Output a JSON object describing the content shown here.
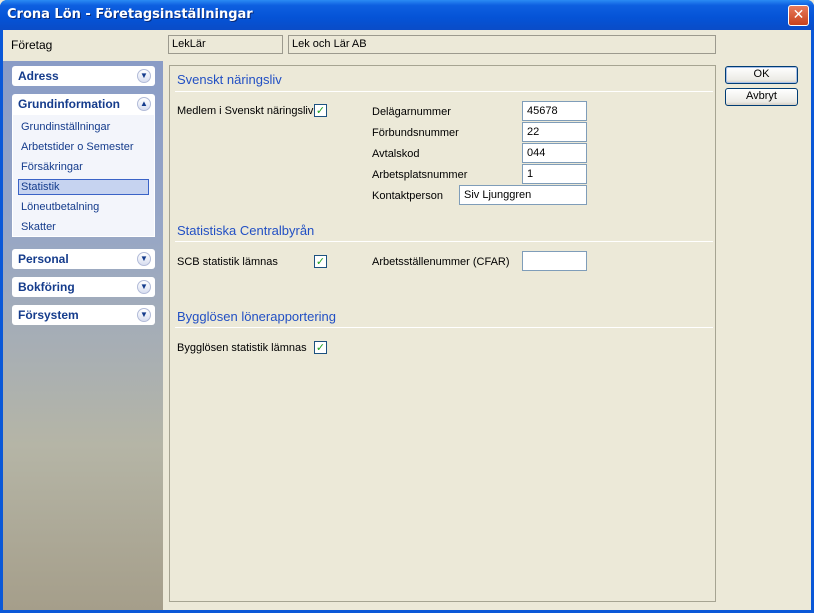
{
  "window": {
    "title": "Crona Lön - Företagsinställningar",
    "close_glyph": "✕"
  },
  "company": {
    "label": "Företag",
    "code": "LekLär",
    "name": "Lek och  Lär AB"
  },
  "sidebar": {
    "groups": [
      {
        "label": "Adress",
        "expanded": false
      },
      {
        "label": "Grundinformation",
        "expanded": true
      },
      {
        "label": "Personal",
        "expanded": false
      },
      {
        "label": "Bokföring",
        "expanded": false
      },
      {
        "label": "Försystem",
        "expanded": false
      }
    ],
    "items": [
      "Grundinställningar",
      "Arbetstider o Semester",
      "Försäkringar",
      "Statistik",
      "Löneutbetalning",
      "Skatter"
    ],
    "selected": "Statistik"
  },
  "sections": {
    "naringsliv": {
      "title": "Svenskt näringsliv",
      "member_label": "Medlem i Svenskt näringsliv",
      "member_checked": true,
      "fields": [
        {
          "label": "Delägarnummer",
          "value": "45678"
        },
        {
          "label": "Förbundsnummer",
          "value": "22"
        },
        {
          "label": "Avtalskod",
          "value": "044"
        },
        {
          "label": "Arbetsplatsnummer",
          "value": "1"
        },
        {
          "label": "Kontaktperson",
          "value": "Siv Ljunggren"
        }
      ]
    },
    "scb": {
      "title": "Statistiska Centralbyrån",
      "check_label": "SCB statistik lämnas",
      "checked": true,
      "field_label": "Arbetsställenummer (CFAR)",
      "field_value": ""
    },
    "bygg": {
      "title": "Bygglösen lönerapportering",
      "check_label": "Bygglösen statistik lämnas",
      "checked": true
    }
  },
  "buttons": {
    "ok": "OK",
    "cancel": "Avbryt"
  },
  "icons": {
    "check": "✓",
    "chevron_down": "⌄",
    "chevron_up": "⌃"
  },
  "colors": {
    "title_blue": "#0553d6",
    "link_blue": "#153c8c",
    "section_blue": "#2250c4"
  }
}
